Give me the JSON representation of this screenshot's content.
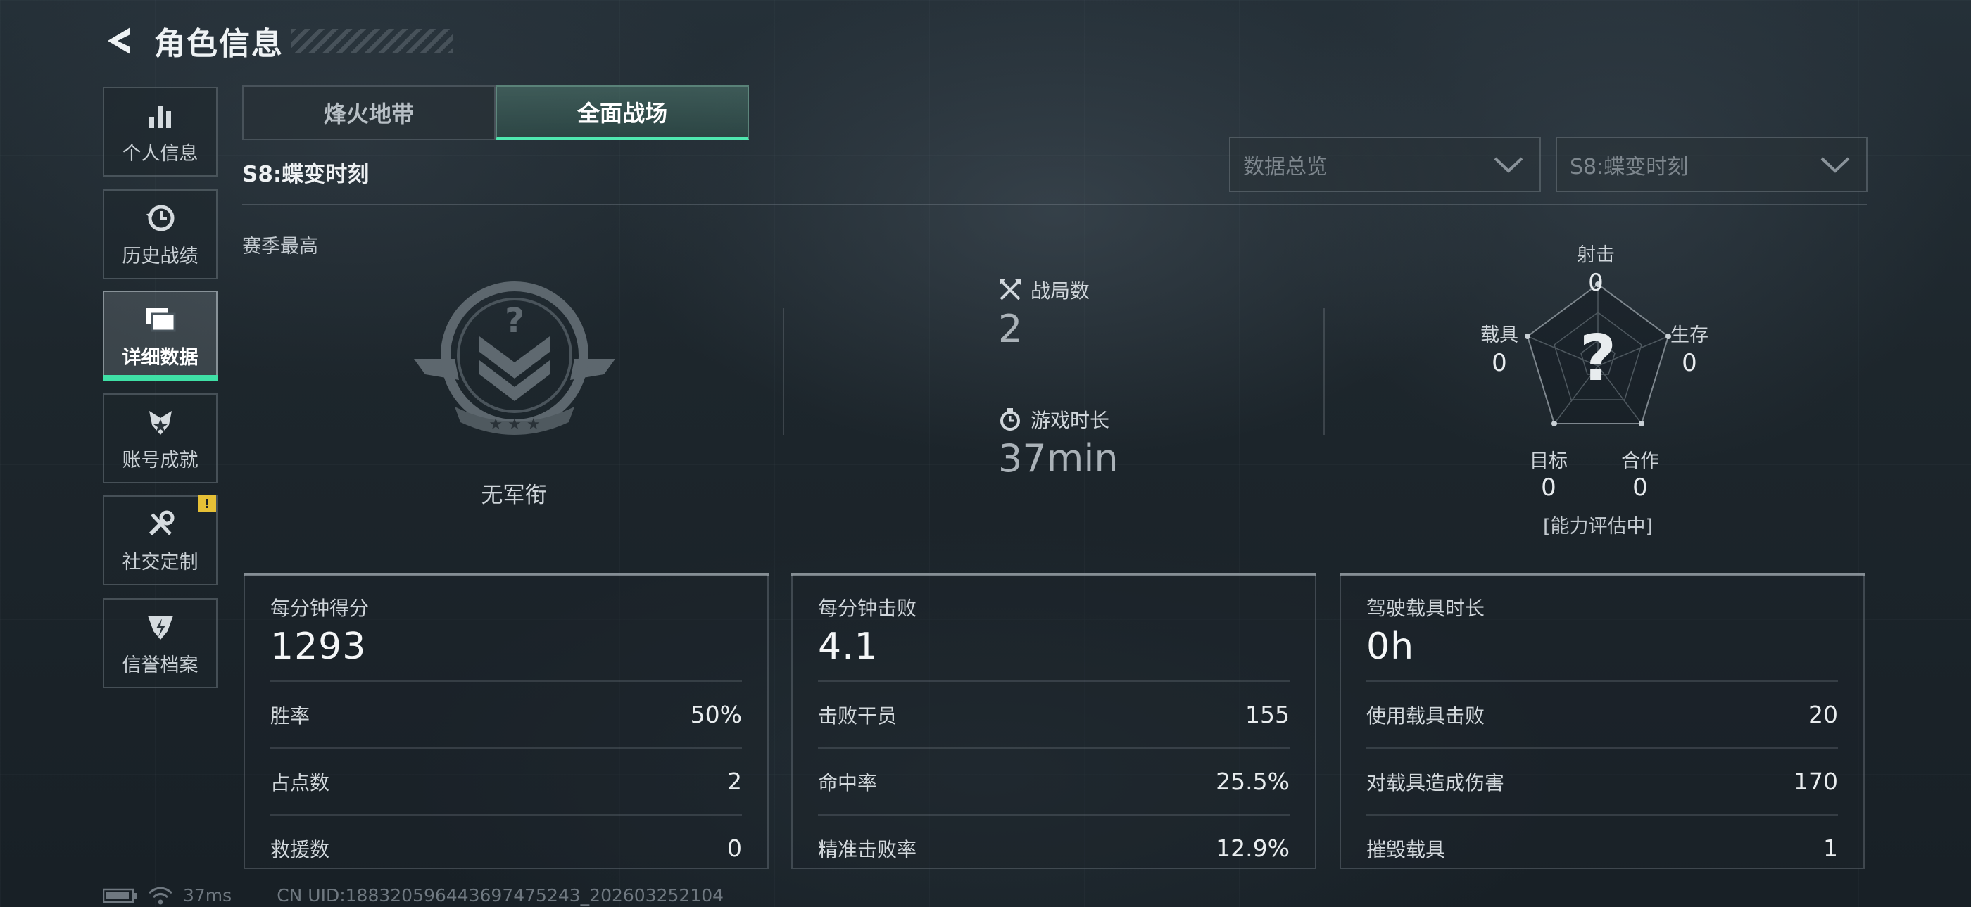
{
  "header": {
    "title": "角色信息",
    "back_icon": "back-arrow-icon"
  },
  "sidebar": {
    "items": [
      {
        "label": "个人信息",
        "icon": "bar-chart-icon",
        "active": false
      },
      {
        "label": "历史战绩",
        "icon": "history-clock-icon",
        "active": false
      },
      {
        "label": "详细数据",
        "icon": "folders-icon",
        "active": true
      },
      {
        "label": "账号成就",
        "icon": "medal-icon",
        "active": false
      },
      {
        "label": "社交定制",
        "icon": "tools-icon",
        "active": false,
        "badge": "!"
      },
      {
        "label": "信誉档案",
        "icon": "shield-bolt-icon",
        "active": false
      }
    ]
  },
  "tabs": [
    {
      "label": "烽火地带",
      "active": false
    },
    {
      "label": "全面战场",
      "active": true
    }
  ],
  "season": "S8:蝶变时刻",
  "filters": {
    "data_type": "数据总览",
    "season": "S8:蝶变时刻"
  },
  "summary": {
    "season_best_label": "赛季最高",
    "rank_name": "无军衔",
    "matches_label": "战局数",
    "matches_value": "2",
    "playtime_label": "游戏时长",
    "playtime_value": "37min"
  },
  "radar": {
    "center_glyph": "?",
    "status": "[能力评估中]",
    "axes": [
      {
        "label": "射击",
        "value": "0"
      },
      {
        "label": "生存",
        "value": "0"
      },
      {
        "label": "合作",
        "value": "0"
      },
      {
        "label": "目标",
        "value": "0"
      },
      {
        "label": "载具",
        "value": "0"
      }
    ]
  },
  "cards": [
    {
      "title": "每分钟得分",
      "value": "1293",
      "rows": [
        {
          "label": "胜率",
          "value": "50%"
        },
        {
          "label": "占点数",
          "value": "2"
        },
        {
          "label": "救援数",
          "value": "0"
        }
      ]
    },
    {
      "title": "每分钟击败",
      "value": "4.1",
      "rows": [
        {
          "label": "击败干员",
          "value": "155"
        },
        {
          "label": "命中率",
          "value": "25.5%"
        },
        {
          "label": "精准击败率",
          "value": "12.9%"
        }
      ]
    },
    {
      "title": "驾驶载具时长",
      "value": "0h",
      "rows": [
        {
          "label": "使用载具击败",
          "value": "20"
        },
        {
          "label": "对载具造成伤害",
          "value": "170"
        },
        {
          "label": "摧毁载具",
          "value": "1"
        }
      ]
    }
  ],
  "footer": {
    "ping": "37ms",
    "uid": "CN UID:18832059644369747524​3_202603252104"
  },
  "colors": {
    "accent": "#4fe8b0",
    "badge": "#e6c036",
    "background": "#1b2228"
  }
}
